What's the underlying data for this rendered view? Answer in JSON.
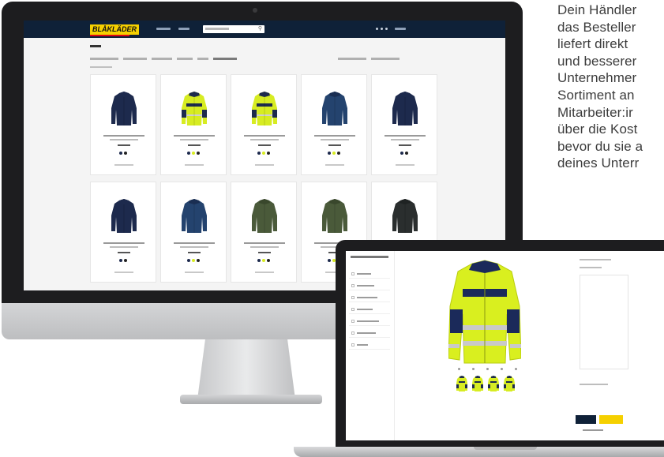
{
  "promo": {
    "lines": [
      "Dein Händler",
      "das Besteller",
      "liefert direkt",
      "und besserer",
      "Unternehmer",
      "Sortiment an",
      "Mitarbeiter:ir",
      "über die Kost",
      "bevor du sie a",
      "deines Unterr"
    ]
  },
  "shop": {
    "logo_text": "BLÅKLÄDER",
    "search_icon": "search-icon",
    "brand_color": "#f5d000",
    "nav_color": "#0f2138",
    "products": [
      {
        "color": "navy",
        "swatches": 2
      },
      {
        "color": "hi-vis-yellow",
        "swatches": 3
      },
      {
        "color": "hi-vis-yellow",
        "swatches": 3
      },
      {
        "color": "blue",
        "swatches": 3
      },
      {
        "color": "navy",
        "swatches": 2
      },
      {
        "color": "navy",
        "swatches": 2
      },
      {
        "color": "blue",
        "swatches": 3
      },
      {
        "color": "olive",
        "swatches": 3
      },
      {
        "color": "olive",
        "swatches": 3
      },
      {
        "color": "black",
        "swatches": 3
      }
    ]
  },
  "configurator": {
    "jacket_print": "",
    "thumbnails": 4,
    "accent_color": "#f5d000"
  }
}
